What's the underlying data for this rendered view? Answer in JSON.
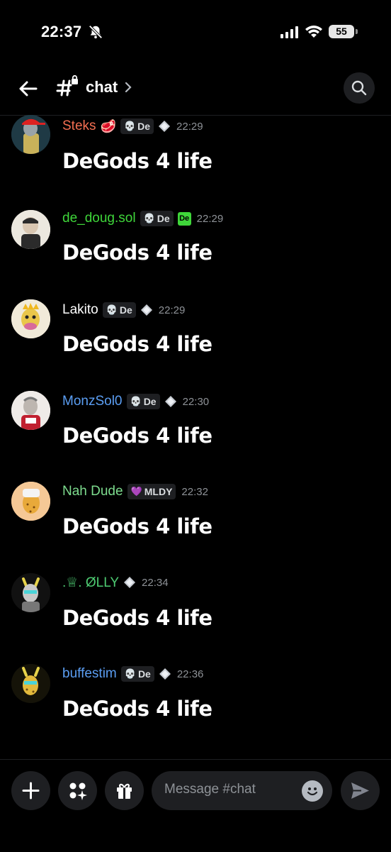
{
  "status_bar": {
    "time": "22:37",
    "battery": "55"
  },
  "header": {
    "channel_name": "chat"
  },
  "messages": [
    {
      "username": "Steks",
      "name_color": "#f46f52",
      "emoji": "🥩",
      "tag": "De",
      "badge": "gem",
      "timestamp": "22:29",
      "text": "DeGods 4 life"
    },
    {
      "username": "de_doug.sol",
      "name_color": "#3fd63a",
      "tag": "De",
      "badge": "De-logo",
      "timestamp": "22:29",
      "text": "DeGods 4 life"
    },
    {
      "username": "Lakito",
      "name_color": "#ffffff",
      "tag": "De",
      "badge": "gem",
      "timestamp": "22:29",
      "text": "DeGods 4 life"
    },
    {
      "username": "MonzSol0",
      "name_color": "#5b9ef3",
      "tag": "De",
      "badge": "gem",
      "timestamp": "22:30",
      "text": "DeGods 4 life"
    },
    {
      "username": "Nah Dude",
      "name_color": "#7ddc8e",
      "tag": "MLDY",
      "badge": "none",
      "timestamp": "22:32",
      "text": "DeGods 4 life"
    },
    {
      "username": ".♕. ØLLY",
      "name_color": "#4ecb72",
      "tag": "",
      "badge": "gem",
      "timestamp": "22:34",
      "text": "DeGods 4 life"
    },
    {
      "username": "buffestim",
      "name_color": "#5b9ef3",
      "tag": "De",
      "badge": "gem",
      "timestamp": "22:36",
      "text": "DeGods 4 life"
    }
  ],
  "composer": {
    "placeholder": "Message #chat"
  }
}
